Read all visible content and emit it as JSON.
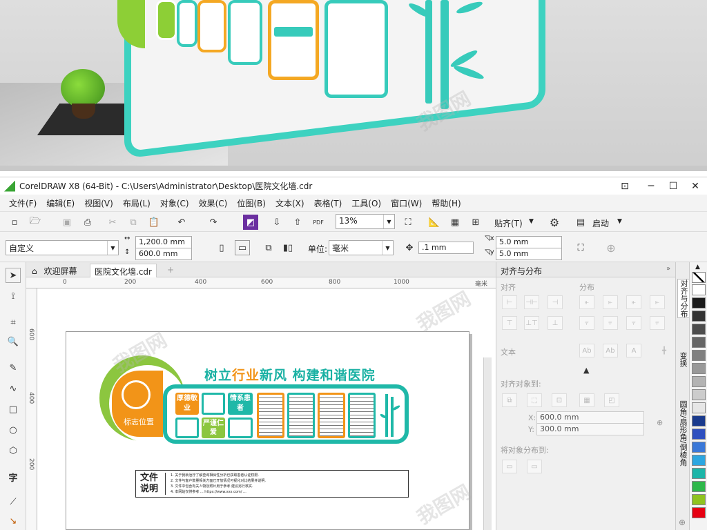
{
  "window": {
    "title": "CorelDRAW X8 (64-Bit) - C:\\Users\\Administrator\\Desktop\\医院文化墙.cdr"
  },
  "menu": [
    "文件(F)",
    "编辑(E)",
    "视图(V)",
    "布局(L)",
    "对象(C)",
    "效果(C)",
    "位图(B)",
    "文本(X)",
    "表格(T)",
    "工具(O)",
    "窗口(W)",
    "帮助(H)"
  ],
  "toolbar": {
    "zoom": "13%",
    "snap_label": "贴齐(T)",
    "launch_label": "启动",
    "pdf_label": "PDF"
  },
  "propbar": {
    "page_preset": "自定义",
    "width": "1,200.0 mm",
    "height": "600.0 mm",
    "units_label": "单位:",
    "units": "毫米",
    "nudge": ".1 mm",
    "dup_x": "5.0 mm",
    "dup_y": "5.0 mm"
  },
  "tabs": {
    "welcome": "欢迎屏幕",
    "document": "医院文化墙.cdr"
  },
  "rulers": {
    "h_ticks": [
      "0",
      "200",
      "400",
      "600",
      "800",
      "1000"
    ],
    "h_unit": "毫米",
    "v_ticks": [
      "600",
      "400",
      "200"
    ]
  },
  "design": {
    "slogan_part1": "树立",
    "slogan_part2": "行业",
    "slogan_part3": "新风  构建和谐医院",
    "logo_label": "标志位置",
    "cell_1": "厚德敬业",
    "cell_2": "情系患者",
    "cell_3": "严谨仁爱",
    "note_title": "文件说明",
    "note_lines": [
      "1. 关于我就治疗了解查询相似性分析已获取患者认证权限.",
      "2. 文件与客户数量相关方面已开放情况可视化对比结果并说明.",
      "3. 文件中包含有关人物及照片用于参考.建议另行核实.",
      "4. 本网站仅供参考 ...  https://www.xxx.com/ ..."
    ]
  },
  "docker": {
    "title": "对齐与分布",
    "align": "对齐",
    "distribute": "分布",
    "text": "文本",
    "align_to": "对齐对象到:",
    "x_label": "X:",
    "x_value": "600.0 mm",
    "y_label": "Y:",
    "y_value": "300.0 mm",
    "distribute_to": "将对象分布到:"
  },
  "side_tabs": [
    "对齐与分布",
    "变换",
    "圆角/扇形角/倒棱角"
  ],
  "palette": [
    "#ffffff",
    "#1a1a1a",
    "#333333",
    "#4d4d4d",
    "#666666",
    "#808080",
    "#999999",
    "#b3b3b3",
    "#cccccc",
    "#e6e6e6",
    "#1a3a8c",
    "#2e4fbf",
    "#3a78d8",
    "#2ca6e0",
    "#1cb5a8",
    "#2eb84a",
    "#8fc31f",
    "#e60012"
  ],
  "watermark": "我图网"
}
